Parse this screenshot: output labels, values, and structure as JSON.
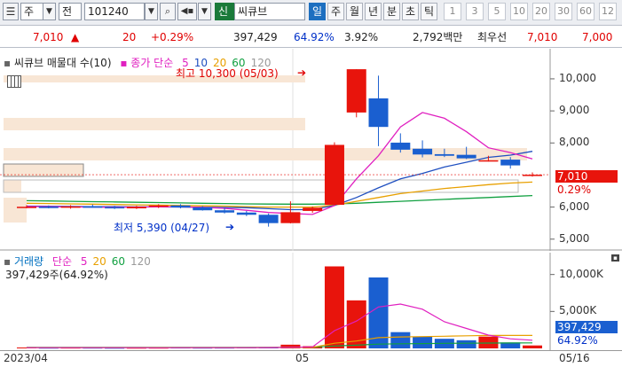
{
  "toolbar": {
    "market_label": "주",
    "category_label": "전",
    "code_value": "101240",
    "stock_name": "씨큐브",
    "stock_tag": "신",
    "periods": [
      {
        "label": "일",
        "active": true
      },
      {
        "label": "주",
        "active": false
      },
      {
        "label": "월",
        "active": false
      },
      {
        "label": "년",
        "active": false
      },
      {
        "label": "분",
        "active": false
      },
      {
        "label": "초",
        "active": false
      },
      {
        "label": "틱",
        "active": false
      }
    ],
    "intervals": [
      "1",
      "3",
      "5",
      "10",
      "20",
      "30",
      "60",
      "12"
    ]
  },
  "quote": {
    "price": "7,010",
    "change_arrow": "▲",
    "change": "20",
    "change_pct": "+0.29%",
    "volume": "397,429",
    "volume_ratio": "64.92%",
    "turnover_ratio": "3.92%",
    "amount": "2,792백만",
    "best_label": "최우선",
    "best_ask": "7,010",
    "best_bid": "7,000"
  },
  "price_panel": {
    "legend_main": "씨큐브 매물대 수(10)",
    "legend_ma_title": "종가 단순",
    "ma_periods": [
      {
        "label": "5",
        "color": "#e020c0"
      },
      {
        "label": "10",
        "color": "#1f4fc0"
      },
      {
        "label": "20",
        "color": "#e8a000"
      },
      {
        "label": "60",
        "color": "#10a040"
      },
      {
        "label": "120",
        "color": "#9a9a9a"
      }
    ],
    "high_annotation": "최고 10,300 (05/03)",
    "low_annotation": "최저 5,390 (04/27)",
    "current_price_tag": "7,010",
    "current_pct_tag": "0.29%",
    "axis_labels": [
      "10,000",
      "9,000",
      "8,000",
      "6,000",
      "5,000"
    ]
  },
  "volume_panel": {
    "legend_title": "거래량",
    "legend_ma_title": "단순",
    "ma_periods": [
      {
        "label": "5",
        "color": "#e020c0"
      },
      {
        "label": "20",
        "color": "#e8a000"
      },
      {
        "label": "60",
        "color": "#10a040"
      },
      {
        "label": "120",
        "color": "#9a9a9a"
      }
    ],
    "summary": "397,429주(64.92%)",
    "axis_labels": [
      "10,000K",
      "5,000K"
    ],
    "current_volume_tag": "397,429",
    "current_pct_tag": "64.92%"
  },
  "x_axis": {
    "labels": [
      "2023/04",
      "05",
      "05/16"
    ]
  },
  "colors": {
    "up": "#e8140c",
    "down": "#1a5fd0",
    "accent": "#1d6fc0"
  },
  "chart_data": {
    "type": "candlestick",
    "candles": [
      {
        "o": 6000,
        "h": 6060,
        "l": 5960,
        "c": 6010
      },
      {
        "o": 6010,
        "h": 6050,
        "l": 5960,
        "c": 5990
      },
      {
        "o": 5980,
        "h": 6060,
        "l": 5950,
        "c": 6020
      },
      {
        "o": 6020,
        "h": 6080,
        "l": 5980,
        "c": 6000
      },
      {
        "o": 6000,
        "h": 6040,
        "l": 5940,
        "c": 5960
      },
      {
        "o": 5960,
        "h": 6040,
        "l": 5940,
        "c": 6010
      },
      {
        "o": 6010,
        "h": 6090,
        "l": 5970,
        "c": 6050
      },
      {
        "o": 6050,
        "h": 6090,
        "l": 5960,
        "c": 5990
      },
      {
        "o": 5990,
        "h": 6030,
        "l": 5890,
        "c": 5900
      },
      {
        "o": 5900,
        "h": 5980,
        "l": 5800,
        "c": 5830
      },
      {
        "o": 5830,
        "h": 5880,
        "l": 5720,
        "c": 5760
      },
      {
        "o": 5760,
        "h": 5800,
        "l": 5390,
        "c": 5500
      },
      {
        "o": 5500,
        "h": 6180,
        "l": 5490,
        "c": 5840
      },
      {
        "o": 5880,
        "h": 6020,
        "l": 5820,
        "c": 5980
      },
      {
        "o": 6070,
        "h": 8020,
        "l": 6050,
        "c": 7940
      },
      {
        "o": 8950,
        "h": 10300,
        "l": 8800,
        "c": 10300
      },
      {
        "o": 9390,
        "h": 10100,
        "l": 7900,
        "c": 8500
      },
      {
        "o": 8010,
        "h": 8300,
        "l": 7700,
        "c": 7790
      },
      {
        "o": 7820,
        "h": 8080,
        "l": 7550,
        "c": 7640
      },
      {
        "o": 7650,
        "h": 7820,
        "l": 7560,
        "c": 7600
      },
      {
        "o": 7630,
        "h": 7880,
        "l": 7500,
        "c": 7520
      },
      {
        "o": 7460,
        "h": 7600,
        "l": 7420,
        "c": 7460
      },
      {
        "o": 7480,
        "h": 7560,
        "l": 7200,
        "c": 7300
      },
      {
        "o": 6990,
        "h": 7080,
        "l": 6950,
        "c": 7010
      }
    ],
    "volume_k": [
      120,
      90,
      100,
      95,
      80,
      85,
      90,
      110,
      95,
      100,
      130,
      180,
      500,
      300,
      11100,
      6500,
      9600,
      2200,
      1600,
      1300,
      1100,
      1600,
      800,
      397
    ],
    "ma5": [
      6020,
      6010,
      6005,
      6000,
      5995,
      6000,
      6005,
      6010,
      5990,
      5960,
      5900,
      5830,
      5800,
      5770,
      6050,
      6880,
      7600,
      8500,
      8950,
      8770,
      8350,
      7850,
      7700,
      7500
    ],
    "ma10": [
      6030,
      6025,
      6020,
      6015,
      6010,
      6005,
      6005,
      6000,
      5995,
      5990,
      5980,
      5950,
      5920,
      5920,
      6050,
      6300,
      6600,
      6880,
      7050,
      7250,
      7400,
      7550,
      7620,
      7740
    ],
    "ma20": [
      6120,
      6110,
      6100,
      6090,
      6080,
      6070,
      6060,
      6050,
      6040,
      6030,
      6010,
      6000,
      6000,
      6000,
      6060,
      6180,
      6300,
      6420,
      6500,
      6580,
      6640,
      6700,
      6750,
      6780
    ],
    "ma60": [
      6200,
      6190,
      6180,
      6170,
      6160,
      6150,
      6140,
      6130,
      6120,
      6110,
      6100,
      6095,
      6090,
      6090,
      6100,
      6120,
      6150,
      6180,
      6210,
      6240,
      6270,
      6300,
      6330,
      6360
    ],
    "vma5": [
      100,
      100,
      100,
      98,
      95,
      92,
      90,
      92,
      94,
      96,
      100,
      110,
      150,
      200,
      2400,
      3700,
      5600,
      6000,
      5300,
      3600,
      2700,
      1800,
      1300,
      1100
    ],
    "vma20": [
      110,
      110,
      110,
      110,
      110,
      110,
      110,
      110,
      110,
      110,
      110,
      115,
      130,
      150,
      700,
      1000,
      1450,
      1550,
      1600,
      1650,
      1700,
      1750,
      1750,
      1750
    ],
    "vma60": [
      130,
      130,
      130,
      130,
      130,
      130,
      130,
      130,
      130,
      130,
      130,
      130,
      135,
      140,
      330,
      430,
      580,
      620,
      650,
      680,
      700,
      720,
      730,
      740
    ],
    "price_ylim": [
      4800,
      10800
    ],
    "volume_ylim": [
      0,
      12000
    ]
  }
}
